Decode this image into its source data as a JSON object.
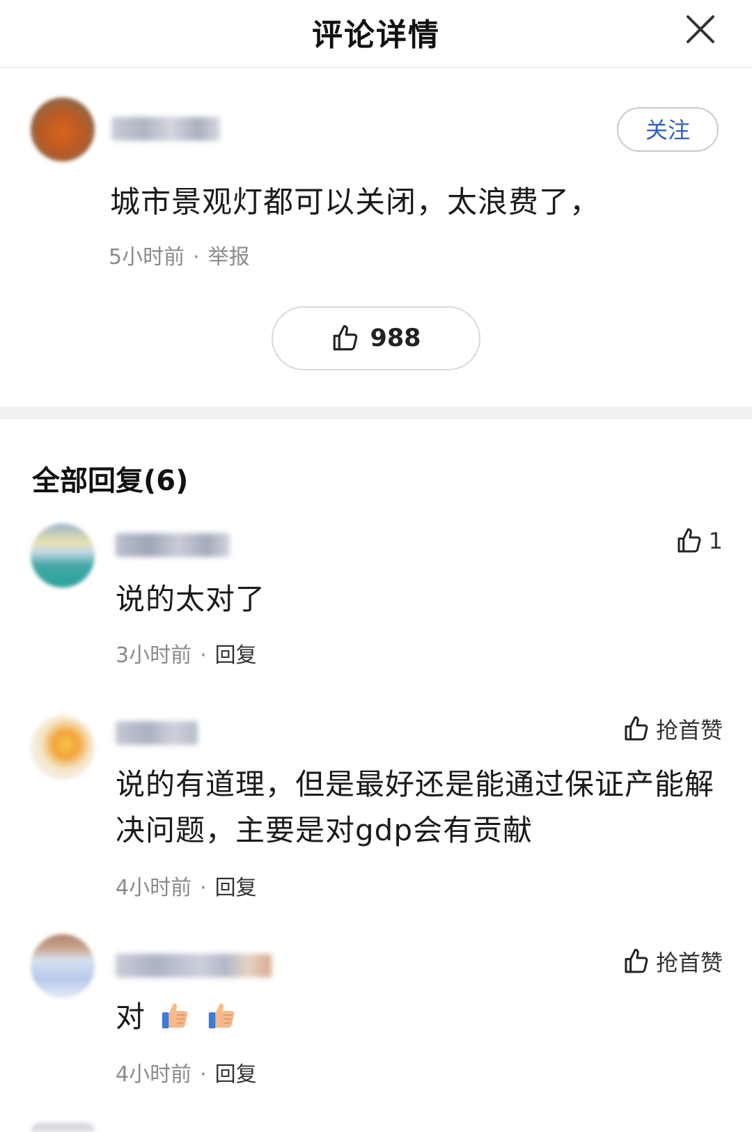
{
  "header": {
    "title": "评论详情"
  },
  "main_comment": {
    "follow_label": "关注",
    "text": "城市景观灯都可以关闭，太浪费了，",
    "time": "5小时前",
    "separator": "·",
    "report_label": "举报",
    "likes": "988"
  },
  "replies_section": {
    "title": "全部回复(6)"
  },
  "replies": [
    {
      "text": "说的太对了",
      "time": "3小时前",
      "separator": "·",
      "reply_label": "回复",
      "likes": "1"
    },
    {
      "text": "说的有道理，但是最好还是能通过保证产能解决问题，主要是对gdp会有贡献",
      "time": "4小时前",
      "separator": "·",
      "reply_label": "回复",
      "likes": "抢首赞"
    },
    {
      "text": "对",
      "time": "4小时前",
      "separator": "·",
      "reply_label": "回复",
      "likes": "抢首赞",
      "emoji": [
        "thumbs-up",
        "thumbs-up"
      ]
    }
  ],
  "colors": {
    "accent": "#2f5fbf",
    "meta": "#8a8a8a",
    "band": "#f1f1f3"
  }
}
